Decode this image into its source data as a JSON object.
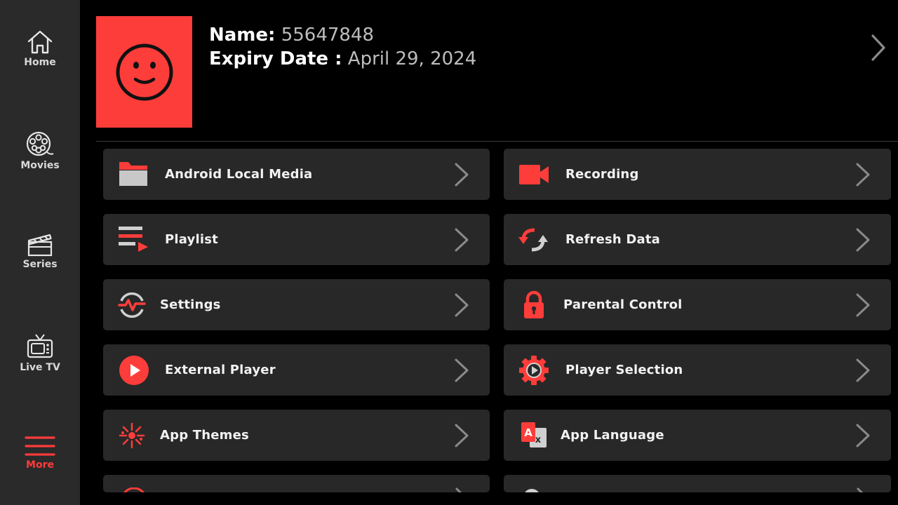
{
  "sidebar": {
    "items": [
      {
        "label": "Home",
        "icon": "home-icon"
      },
      {
        "label": "Movies",
        "icon": "film-reel-icon"
      },
      {
        "label": "Series",
        "icon": "clapperboard-icon"
      },
      {
        "label": "Live TV",
        "icon": "tv-icon"
      },
      {
        "label": "More",
        "icon": "menu-icon",
        "active": true
      }
    ]
  },
  "profile": {
    "name_label": "Name:",
    "name_value": "55647848",
    "expiry_label": "Expiry Date :",
    "expiry_value": "April 29, 2024",
    "avatar_icon": "smiley-face-icon"
  },
  "menu": {
    "left": [
      {
        "label": "Android Local Media",
        "icon": "folder-icon"
      },
      {
        "label": "Playlist",
        "icon": "playlist-icon"
      },
      {
        "label": "Settings",
        "icon": "settings-pulse-icon"
      },
      {
        "label": "External Player",
        "icon": "play-circle-icon"
      },
      {
        "label": "App Themes",
        "icon": "splash-icon"
      }
    ],
    "right": [
      {
        "label": "Recording",
        "icon": "video-camera-icon"
      },
      {
        "label": "Refresh Data",
        "icon": "refresh-icon"
      },
      {
        "label": "Parental Control",
        "icon": "lock-icon"
      },
      {
        "label": "Player Selection",
        "icon": "gear-play-icon"
      },
      {
        "label": "App Language",
        "icon": "translate-icon"
      }
    ]
  },
  "colors": {
    "accent": "#fd3d3a",
    "background": "#000000",
    "sidebar": "#2a2a2a",
    "card": "#282828"
  }
}
